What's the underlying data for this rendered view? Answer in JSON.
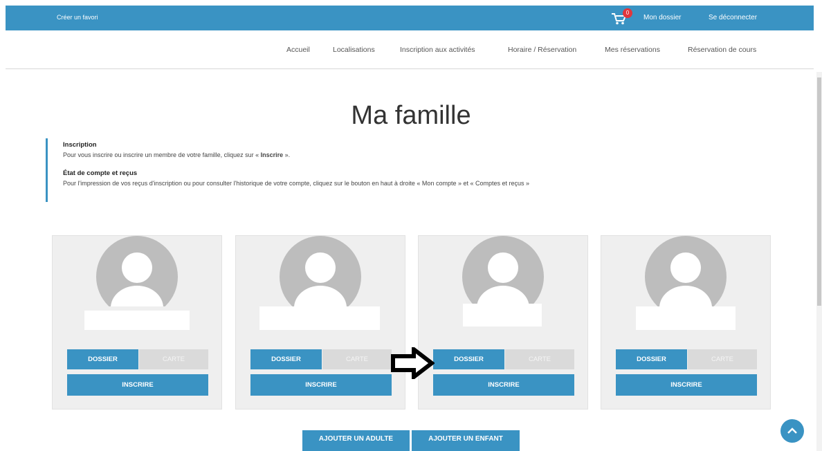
{
  "topbar": {
    "left_link": "Créer un favori",
    "cart_count": "0",
    "my_file": "Mon dossier",
    "logout": "Se déconnecter"
  },
  "menu": [
    "Accueil",
    "Localisations",
    "Inscription aux activités",
    "Horaire / Réservation",
    "Mes réservations",
    "Réservation de cours"
  ],
  "page_title": "Ma famille",
  "info": {
    "inscription_heading": "Inscription",
    "inscription_text_before": "Pour vous inscrire ou inscrire un membre de votre famille, cliquez sur « ",
    "inscription_text_bold": "Inscrire",
    "inscription_text_after": " ».",
    "account_heading": "État de compte et reçus",
    "account_text": "Pour l'impression de vos reçus d'inscription ou pour consulter l'historique de votre compte, cliquez sur le bouton en haut à droite « Mon compte » et « Comptes et reçus »"
  },
  "cards": [
    {
      "dossier": "DOSSIER",
      "carte": "CARTE",
      "inscrire": "INSCRIRE"
    },
    {
      "dossier": "DOSSIER",
      "carte": "CARTE",
      "inscrire": "INSCRIRE"
    },
    {
      "dossier": "DOSSIER",
      "carte": "CARTE",
      "inscrire": "INSCRIRE"
    },
    {
      "dossier": "DOSSIER",
      "carte": "CARTE",
      "inscrire": "INSCRIRE"
    }
  ],
  "actions": {
    "add_adult": "AJOUTER UN ADULTE",
    "add_child": "AJOUTER UN ENFANT"
  },
  "colors": {
    "accent": "#3a93c3",
    "badge": "#e0363c",
    "card_bg": "#efefef",
    "disabled_button": "#dadada"
  },
  "icons": [
    "cart-icon",
    "avatar-placeholder-icon",
    "pointer-arrow-icon",
    "chevron-up-icon"
  ]
}
